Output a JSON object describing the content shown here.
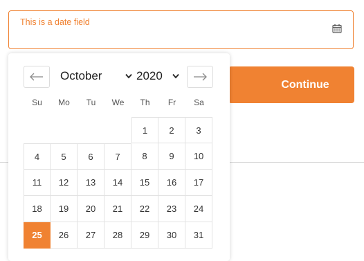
{
  "date_field": {
    "label": "This is a date field",
    "icon": "calendar-icon"
  },
  "continue_button": {
    "label": "Continue"
  },
  "datepicker": {
    "prev_icon": "arrow-left-icon",
    "next_icon": "arrow-right-icon",
    "month": "October",
    "year": "2020",
    "weekdays": [
      "Su",
      "Mo",
      "Tu",
      "We",
      "Th",
      "Fr",
      "Sa"
    ],
    "weeks": [
      [
        "",
        "",
        "",
        "",
        "1",
        "2",
        "3"
      ],
      [
        "4",
        "5",
        "6",
        "7",
        "8",
        "9",
        "10"
      ],
      [
        "11",
        "12",
        "13",
        "14",
        "15",
        "16",
        "17"
      ],
      [
        "18",
        "19",
        "20",
        "21",
        "22",
        "23",
        "24"
      ],
      [
        "25",
        "26",
        "27",
        "28",
        "29",
        "30",
        "31"
      ]
    ],
    "selected_day": "25"
  },
  "colors": {
    "accent": "#f08232",
    "border": "#e2e2e2",
    "text": "#333333"
  }
}
